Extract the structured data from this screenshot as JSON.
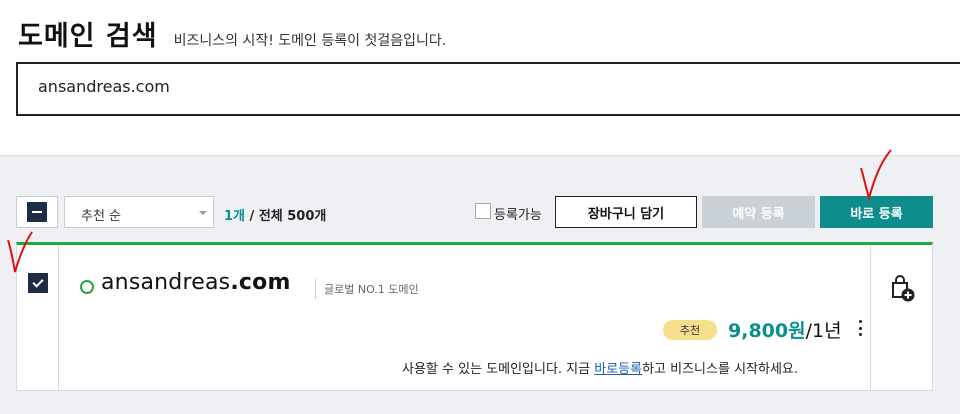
{
  "header": {
    "title": "도메인 검색",
    "subtitle": "비즈니스의 시작! 도메인 등록이 첫걸음입니다."
  },
  "search": {
    "value": "ansandreas.com"
  },
  "toolbar": {
    "sort_value": "추천 순",
    "count_num": "1개",
    "count_total": "/ 전체 500개",
    "available_label": "등록가능",
    "cart_label": "장바구니 담기",
    "reserve_label": "예약 등록",
    "register_label": "바로 등록"
  },
  "results": [
    {
      "domain_name": "ansandreas",
      "domain_tld": ".com",
      "tag": "글로벌 NO.1 도메인",
      "badge": "추천",
      "price_amount": "9,800원",
      "price_period": "/1년",
      "info_prefix": "사용할 수 있는 도메인입니다. 지금 ",
      "info_link": "바로등록",
      "info_suffix": "하고 비즈니스를 시작하세요.",
      "selected": true,
      "available": true
    }
  ],
  "colors": {
    "accent_teal": "#0f8c8c",
    "available_green": "#22a83a",
    "annotation_red": "#e01010",
    "badge_yellow": "#f5df8c"
  },
  "icons": {
    "cart_add": "shopping-bag-plus-icon",
    "row_more": "kebab-menu-icon"
  }
}
